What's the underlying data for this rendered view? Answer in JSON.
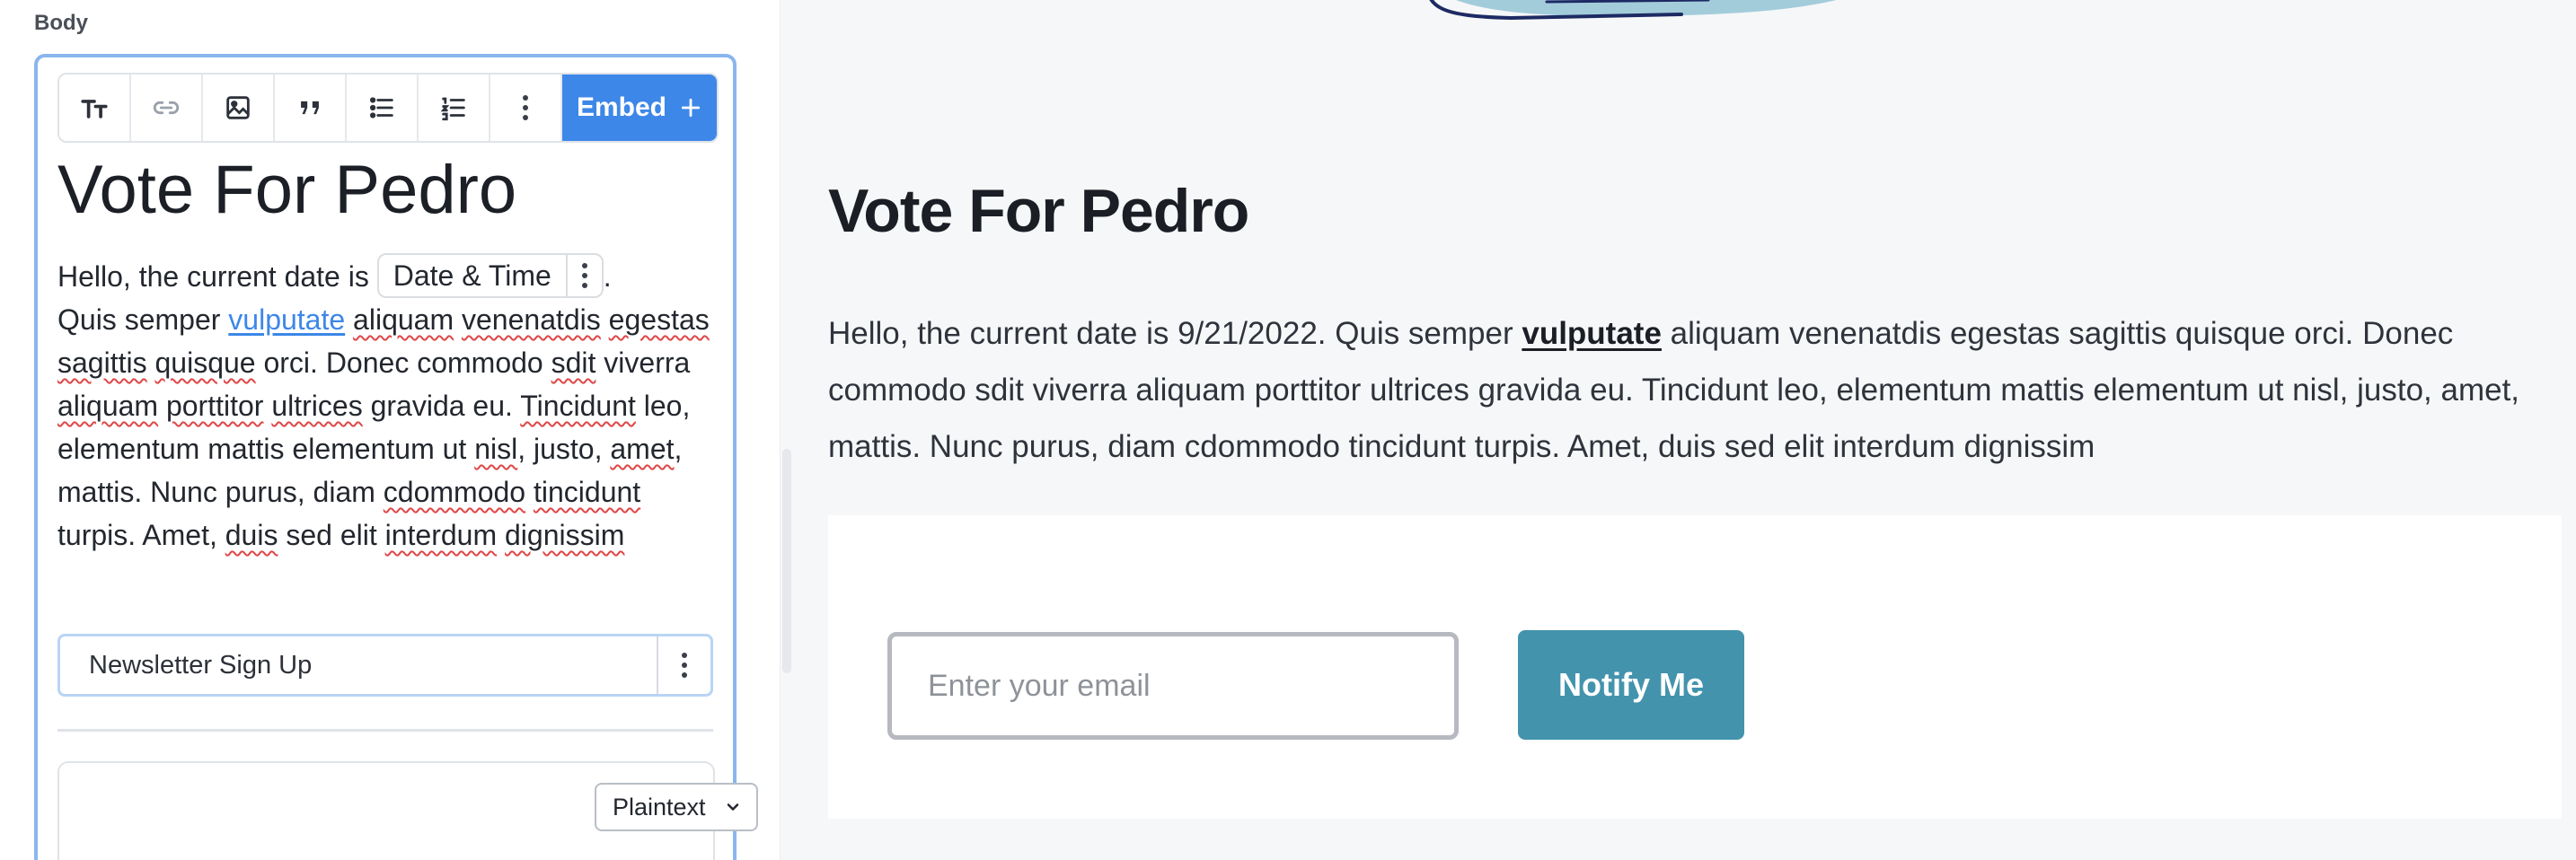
{
  "editor": {
    "section_label": "Body",
    "toolbar": {
      "buttons": [
        {
          "name": "text-size-icon"
        },
        {
          "name": "link-icon"
        },
        {
          "name": "image-icon"
        },
        {
          "name": "quote-icon"
        },
        {
          "name": "bullet-list-icon"
        },
        {
          "name": "numbered-list-icon"
        },
        {
          "name": "more-vertical-icon"
        }
      ],
      "embed_label": "Embed",
      "embed_icon": "plus-icon"
    },
    "title": "Vote For Pedro",
    "paragraph": {
      "before_chip": "Hello, the current date is ",
      "chip_label": "Date & Time",
      "after_chip": ".",
      "line2_start": "Quis semper ",
      "link_text": "vulputate",
      "rest": {
        "w1": "aliquam",
        "w2": "venenatdis",
        "w3": "egestas",
        "w4": "sagittis",
        "w5": "quisque",
        "t1": " orci. Donec commodo ",
        "w6": "sdit",
        "t2": " viverra ",
        "w7": "aliquam",
        "w8": "porttitor",
        "w9": "ultrices",
        "t3": " gravida eu. ",
        "w10": "Tincidunt",
        "t4": " leo, elementum mattis elementum ut ",
        "w11": "nisl",
        "t5": ", justo, ",
        "w12": "amet",
        "t6": ", mattis. Nunc purus, diam ",
        "w13": "cdommodo",
        "w14": "tincidunt",
        "t7": " turpis. Amet, ",
        "w15": "duis",
        "t8": " sed elit ",
        "w16": "interdum",
        "w17": "dignissim"
      }
    },
    "newsletter_block_label": "Newsletter Sign Up",
    "code_block": {
      "language": "Plaintext"
    }
  },
  "preview": {
    "title": "Vote For Pedro",
    "paragraph_start": "Hello, the current date is 9/21/2022. Quis semper ",
    "link_text": "vulputate",
    "paragraph_end": " aliquam venenatdis egestas sagittis quisque orci. Donec commodo sdit viverra aliquam porttitor ultrices gravida eu. Tincidunt leo, elementum mattis elementum ut nisl, justo, amet, mattis. Nunc purus, diam cdommodo tincidunt turpis. Amet, duis sed elit interdum dignissim",
    "signup": {
      "email_placeholder": "Enter your email",
      "button_label": "Notify Me"
    }
  },
  "colors": {
    "accent_blue": "#3d87e8",
    "notify_button": "#4393ad",
    "editor_focus_border": "#8ab6ee"
  }
}
